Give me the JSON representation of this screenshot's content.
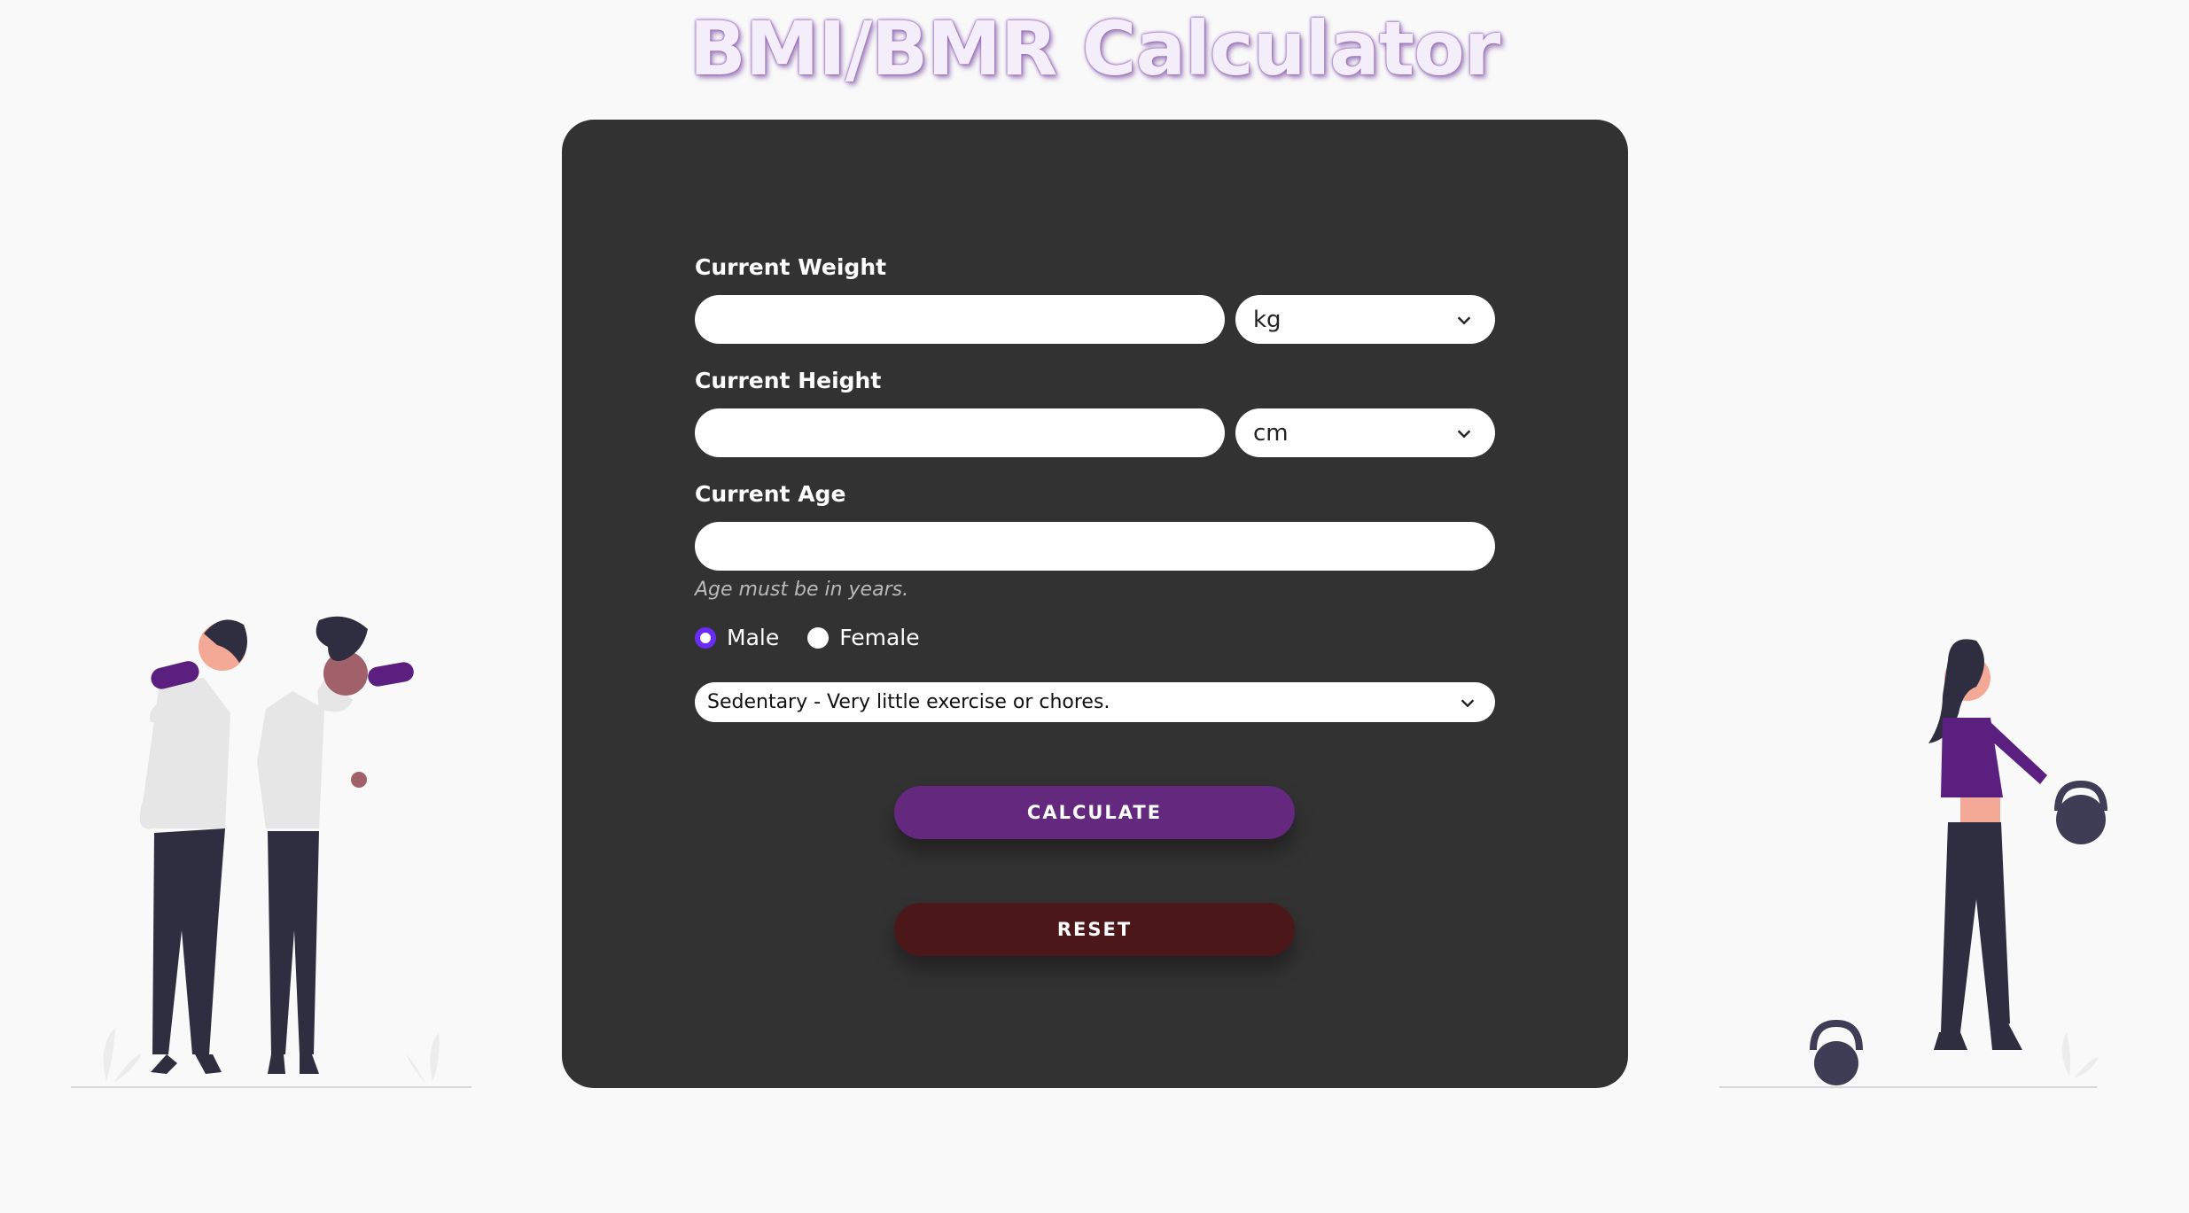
{
  "title": "BMI/BMR Calculator",
  "form": {
    "weight_label": "Current Weight",
    "weight_value": "",
    "weight_unit": "kg",
    "height_label": "Current Height",
    "height_value": "",
    "height_unit": "cm",
    "age_label": "Current Age",
    "age_value": "",
    "age_hint": "Age must be in years.",
    "gender_options": [
      {
        "label": "Male",
        "selected": true
      },
      {
        "label": "Female",
        "selected": false
      }
    ],
    "activity_selected": "Sedentary - Very little exercise or chores."
  },
  "buttons": {
    "calculate": "CALCULATE",
    "reset": "RESET"
  },
  "colors": {
    "card": "#323232",
    "accent_radio": "#6a2cf5",
    "calculate": "#64287e",
    "reset": "#4b1718",
    "page_bg": "#f9f9f9"
  },
  "icons": {
    "select_arrow": "chevron-down-icon"
  }
}
